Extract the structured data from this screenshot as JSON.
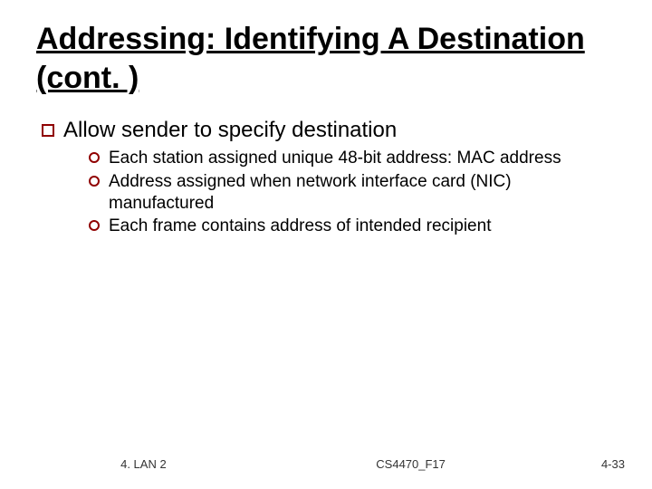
{
  "title": "Addressing: Identifying A Destination (cont. )",
  "bullet1": "Allow sender to specify destination",
  "sub": [
    "Each station assigned unique 48-bit address: MAC address",
    "Address assigned when network interface card (NIC) manufactured",
    "Each frame contains address of intended recipient"
  ],
  "footer": {
    "left": "4. LAN 2",
    "center": "CS4470_F17",
    "right": "4-33"
  }
}
